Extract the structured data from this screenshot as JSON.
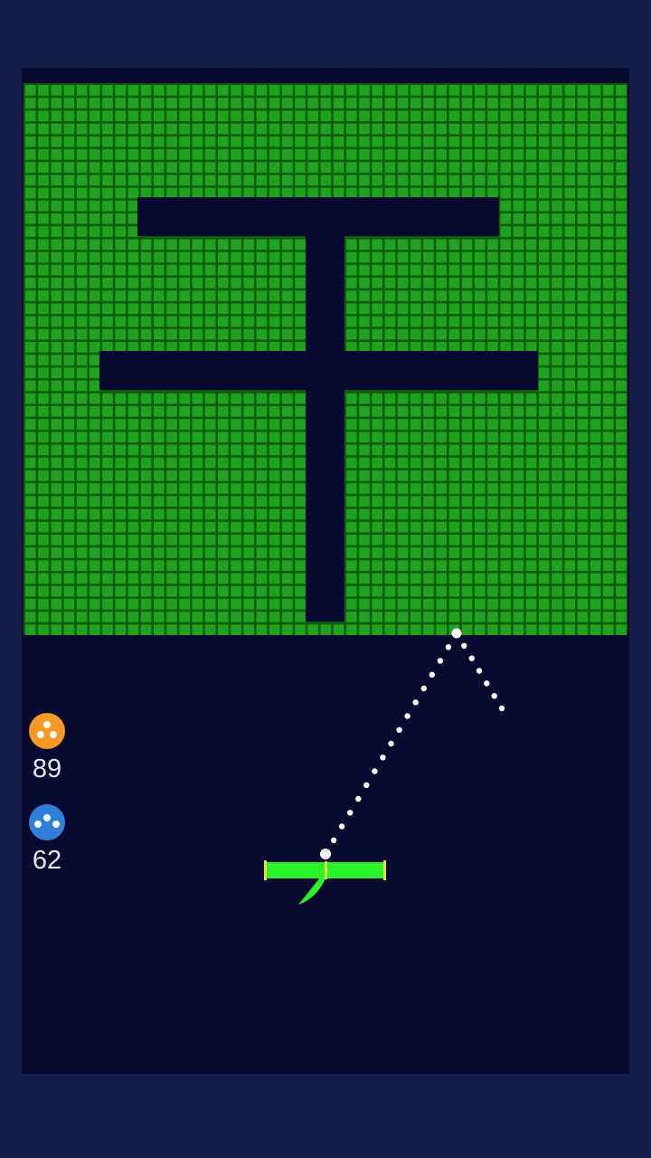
{
  "game": {
    "brick_color": "#1fa31f",
    "brick_edge_color": "#0c5c0c",
    "field_color": "#060a30",
    "frame_color": "#121c48",
    "paddle_color": "#2cf22c",
    "paddle_cap_color": "#e7e23a",
    "ball_color": "#ffffff"
  },
  "powerups": [
    {
      "name": "multi-ball-orange",
      "icon": "three-balls-icon",
      "color": "#f59a22",
      "count": "89"
    },
    {
      "name": "spread-ball-blue",
      "icon": "spread-balls-icon",
      "color": "#2f7fd9",
      "count": "62"
    }
  ]
}
